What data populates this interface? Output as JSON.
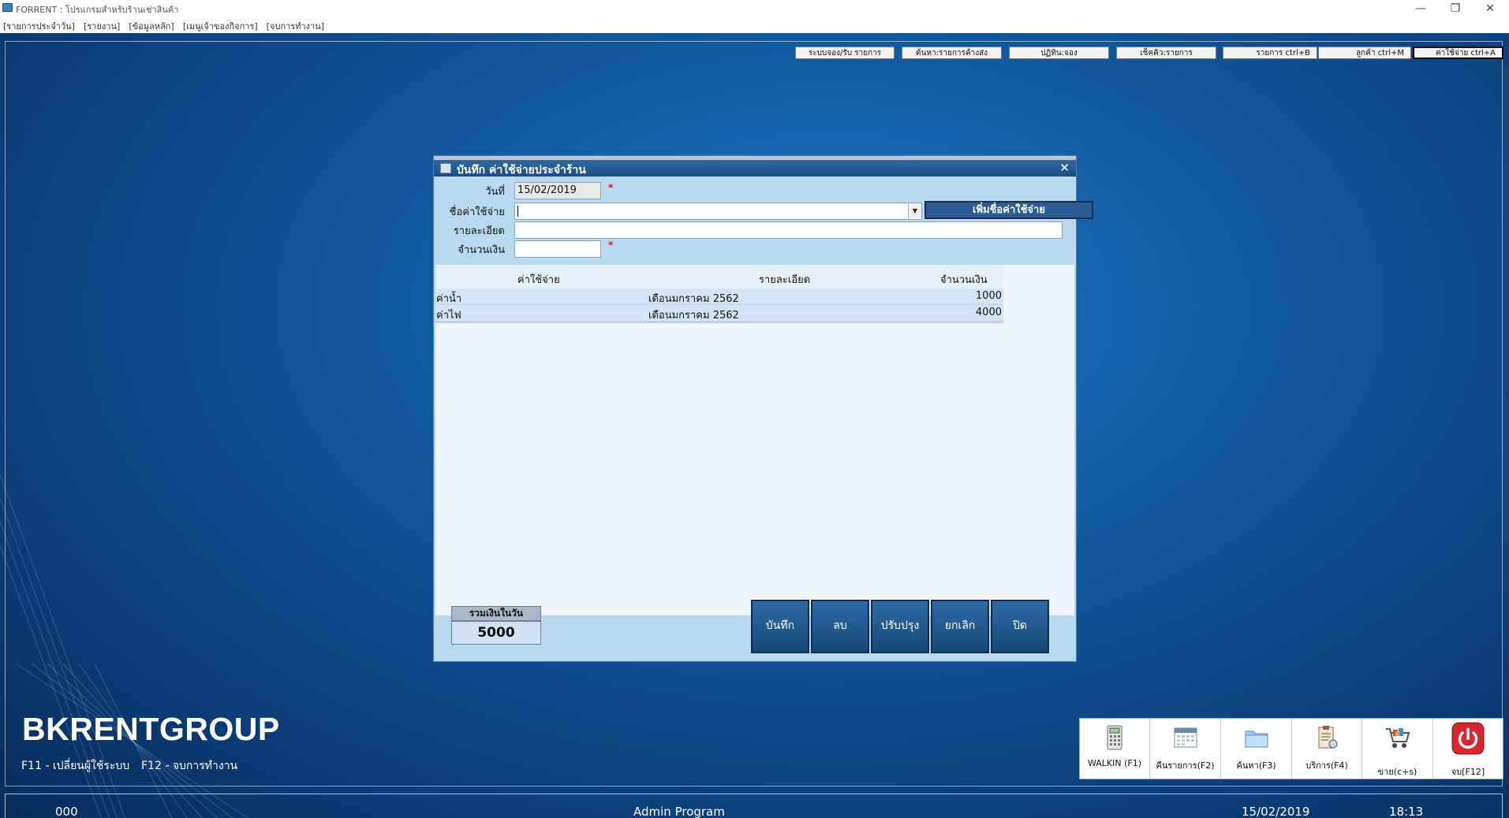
{
  "titlebar": {
    "title": "FORRENT : โปรแกรมสำหรับร้านเช่าสินค้า",
    "minimize_icon": "—",
    "restore_icon": "❐",
    "close_icon": "✕"
  },
  "menubar": {
    "items": [
      "[รายการประจำวัน]",
      "[รายงาน]",
      "[ข้อมูลหลัก]",
      "[เมนูเจ้าของกิจการ]",
      "[จบการทำงาน]"
    ]
  },
  "quick_buttons": [
    "ระบบจอง/รับ รายการ",
    "ค้นหา:รายการค้างส่ง",
    "ปฏิทิน:จอง",
    "เช็คคิว:รายการ",
    "รายการ ctrl+B",
    "ลูกค้า ctrl+M",
    "ค่าใช้จ่าย ctrl+A"
  ],
  "dialog": {
    "title": "บันทึก ค่าใช้จ่ายประจำร้าน",
    "close_icon": "✕",
    "labels": {
      "date": "วันที่",
      "expense_name": "ชื่อค่าใช้จ่าย",
      "detail": "รายละเอียด",
      "amount": "จำนวนเงิน"
    },
    "values": {
      "date": "15/02/2019",
      "expense_name": "",
      "detail": "",
      "amount": ""
    },
    "required_mark": "*",
    "add_expense_button": "เพิ่มชื่อค่าใช้จ่าย",
    "grid": {
      "headers": [
        "ค่าใช้จ่าย",
        "รายละเอียด",
        "จำนวนเงิน"
      ],
      "rows": [
        {
          "expense": "ค่าน้ำ",
          "detail": "เดือนมกราคม 2562",
          "amount": "1000"
        },
        {
          "expense": "ค่าไฟ",
          "detail": "เดือนมกราคม 2562",
          "amount": "4000"
        }
      ]
    },
    "total_label": "รวมเงินในวัน",
    "total_value": "5000",
    "buttons": {
      "save": "บันทึก",
      "delete": "ลบ",
      "update": "ปรับปรุง",
      "cancel": "ยกเลิก",
      "close": "ปิด"
    }
  },
  "brand": "BKRENTGROUP",
  "hints": {
    "f11": "F11 - เปลี่ยนผู้ใช้ระบบ",
    "f12": "F12 - จบการทำงาน"
  },
  "toolbar": [
    {
      "label": "WALKIN  (F1)",
      "icon": "calculator-icon"
    },
    {
      "label": "คืนรายการ(F2)",
      "icon": "calendar-icon"
    },
    {
      "label": "ค้นหา(F3)",
      "icon": "folder-icon"
    },
    {
      "label": "บริการ(F4)",
      "icon": "clipboard-icon"
    },
    {
      "label": "ขาย(c+s)",
      "icon": "cart-icon"
    },
    {
      "label": "จบ[F12]",
      "icon": "power-icon"
    }
  ],
  "statusbar": {
    "code": "000",
    "user": "Admin Program",
    "date": "15/02/2019",
    "time": "18:13"
  },
  "colors": {
    "desktop": "#135aa0",
    "dialog_bg": "#b9d9ef",
    "button": "#1f5a93",
    "power": "#d9262c"
  }
}
